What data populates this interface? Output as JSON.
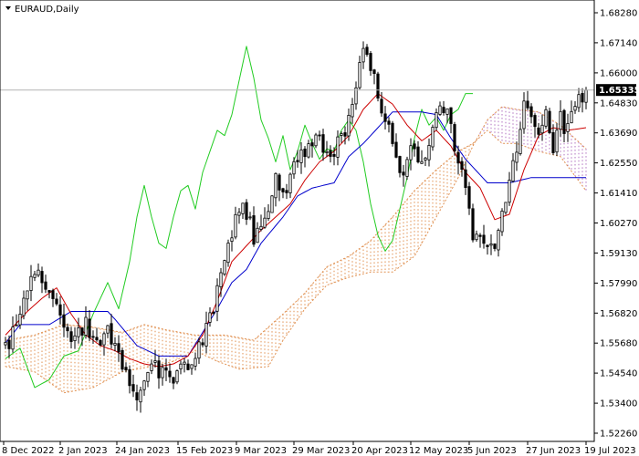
{
  "chart_data": {
    "type": "candlestick",
    "title": "EURAUD,Daily",
    "current_price": "1.65335",
    "y_ticks": [
      "1.68280",
      "1.67140",
      "1.66000",
      "1.64830",
      "1.63690",
      "1.62550",
      "1.61410",
      "1.60270",
      "1.59130",
      "1.57990",
      "1.56820",
      "1.55680",
      "1.54540",
      "1.53400",
      "1.52260"
    ],
    "ylim": [
      1.5226,
      1.6828
    ],
    "x_ticks": [
      {
        "label": "8 Dec 2022",
        "index": 0
      },
      {
        "label": "2 Jan 2023",
        "index": 17
      },
      {
        "label": "24 Jan 2023",
        "index": 33
      },
      {
        "label": "15 Feb 2023",
        "index": 49
      },
      {
        "label": "9 Mar 2023",
        "index": 65
      },
      {
        "label": "29 Mar 2023",
        "index": 79
      },
      {
        "label": "20 Apr 2023",
        "index": 95
      },
      {
        "label": "12 May 2023",
        "index": 111
      },
      {
        "label": "5 Jun 2023",
        "index": 127
      },
      {
        "label": "27 Jun 2023",
        "index": 143
      },
      {
        "label": "19 Jul 2023",
        "index": 159
      }
    ],
    "bar_count": 160,
    "price_path": [
      [
        0,
        1.556
      ],
      [
        3,
        1.562
      ],
      [
        6,
        1.579
      ],
      [
        9,
        1.583
      ],
      [
        12,
        1.576
      ],
      [
        16,
        1.564
      ],
      [
        19,
        1.558
      ],
      [
        22,
        1.565
      ],
      [
        25,
        1.556
      ],
      [
        28,
        1.562
      ],
      [
        31,
        1.55
      ],
      [
        34,
        1.54
      ],
      [
        36,
        1.532
      ],
      [
        38,
        1.54
      ],
      [
        41,
        1.548
      ],
      [
        44,
        1.546
      ],
      [
        47,
        1.544
      ],
      [
        50,
        1.549
      ],
      [
        53,
        1.556
      ],
      [
        56,
        1.566
      ],
      [
        59,
        1.582
      ],
      [
        62,
        1.6
      ],
      [
        65,
        1.61
      ],
      [
        68,
        1.598
      ],
      [
        71,
        1.605
      ],
      [
        74,
        1.618
      ],
      [
        77,
        1.615
      ],
      [
        80,
        1.626
      ],
      [
        83,
        1.632
      ],
      [
        86,
        1.635
      ],
      [
        89,
        1.628
      ],
      [
        92,
        1.635
      ],
      [
        95,
        1.648
      ],
      [
        97,
        1.662
      ],
      [
        99,
        1.67
      ],
      [
        101,
        1.656
      ],
      [
        103,
        1.648
      ],
      [
        105,
        1.64
      ],
      [
        107,
        1.628
      ],
      [
        109,
        1.623
      ],
      [
        111,
        1.63
      ],
      [
        113,
        1.626
      ],
      [
        116,
        1.63
      ],
      [
        118,
        1.642
      ],
      [
        120,
        1.647
      ],
      [
        122,
        1.64
      ],
      [
        124,
        1.625
      ],
      [
        126,
        1.615
      ],
      [
        128,
        1.6
      ],
      [
        130,
        1.596
      ],
      [
        132,
        1.592
      ],
      [
        134,
        1.595
      ],
      [
        136,
        1.606
      ],
      [
        138,
        1.621
      ],
      [
        140,
        1.633
      ],
      [
        142,
        1.647
      ],
      [
        144,
        1.64
      ],
      [
        146,
        1.636
      ],
      [
        148,
        1.644
      ],
      [
        150,
        1.63
      ],
      [
        152,
        1.642
      ],
      [
        154,
        1.637
      ],
      [
        156,
        1.648
      ],
      [
        159,
        1.6533
      ]
    ],
    "tenkan_path": [
      [
        0,
        1.56
      ],
      [
        6,
        1.569
      ],
      [
        10,
        1.574
      ],
      [
        14,
        1.578
      ],
      [
        18,
        1.568
      ],
      [
        22,
        1.56
      ],
      [
        26,
        1.556
      ],
      [
        30,
        1.554
      ],
      [
        34,
        1.551
      ],
      [
        38,
        1.549
      ],
      [
        42,
        1.548
      ],
      [
        46,
        1.549
      ],
      [
        50,
        1.552
      ],
      [
        54,
        1.56
      ],
      [
        58,
        1.573
      ],
      [
        62,
        1.588
      ],
      [
        66,
        1.594
      ],
      [
        70,
        1.6
      ],
      [
        74,
        1.605
      ],
      [
        78,
        1.61
      ],
      [
        82,
        1.619
      ],
      [
        86,
        1.626
      ],
      [
        90,
        1.63
      ],
      [
        94,
        1.636
      ],
      [
        98,
        1.646
      ],
      [
        102,
        1.652
      ],
      [
        106,
        1.648
      ],
      [
        110,
        1.64
      ],
      [
        114,
        1.634
      ],
      [
        118,
        1.638
      ],
      [
        122,
        1.632
      ],
      [
        126,
        1.622
      ],
      [
        130,
        1.616
      ],
      [
        134,
        1.604
      ],
      [
        138,
        1.606
      ],
      [
        142,
        1.623
      ],
      [
        146,
        1.636
      ],
      [
        150,
        1.639
      ],
      [
        154,
        1.638
      ],
      [
        159,
        1.639
      ]
    ],
    "kijun_path": [
      [
        0,
        1.557
      ],
      [
        4,
        1.564
      ],
      [
        12,
        1.564
      ],
      [
        18,
        1.569
      ],
      [
        28,
        1.569
      ],
      [
        30,
        1.566
      ],
      [
        36,
        1.556
      ],
      [
        42,
        1.552
      ],
      [
        50,
        1.552
      ],
      [
        54,
        1.561
      ],
      [
        58,
        1.57
      ],
      [
        62,
        1.58
      ],
      [
        66,
        1.585
      ],
      [
        70,
        1.595
      ],
      [
        76,
        1.605
      ],
      [
        80,
        1.613
      ],
      [
        84,
        1.616
      ],
      [
        90,
        1.618
      ],
      [
        94,
        1.628
      ],
      [
        98,
        1.633
      ],
      [
        106,
        1.645
      ],
      [
        114,
        1.645
      ],
      [
        118,
        1.644
      ],
      [
        122,
        1.635
      ],
      [
        126,
        1.627
      ],
      [
        132,
        1.618
      ],
      [
        138,
        1.618
      ],
      [
        144,
        1.62
      ],
      [
        159,
        1.62
      ]
    ],
    "chikou_path": [
      [
        0,
        1.551
      ],
      [
        4,
        1.555
      ],
      [
        8,
        1.54
      ],
      [
        12,
        1.543
      ],
      [
        16,
        1.552
      ],
      [
        20,
        1.554
      ],
      [
        24,
        1.568
      ],
      [
        28,
        1.58
      ],
      [
        31,
        1.57
      ],
      [
        34,
        1.588
      ],
      [
        36,
        1.605
      ],
      [
        38,
        1.617
      ],
      [
        40,
        1.605
      ],
      [
        42,
        1.595
      ],
      [
        44,
        1.593
      ],
      [
        46,
        1.605
      ],
      [
        48,
        1.615
      ],
      [
        50,
        1.617
      ],
      [
        52,
        1.608
      ],
      [
        54,
        1.622
      ],
      [
        56,
        1.63
      ],
      [
        58,
        1.638
      ],
      [
        60,
        1.636
      ],
      [
        62,
        1.644
      ],
      [
        64,
        1.657
      ],
      [
        66,
        1.67
      ],
      [
        68,
        1.658
      ],
      [
        70,
        1.642
      ],
      [
        72,
        1.635
      ],
      [
        74,
        1.626
      ],
      [
        76,
        1.636
      ],
      [
        78,
        1.623
      ],
      [
        80,
        1.63
      ],
      [
        82,
        1.64
      ],
      [
        84,
        1.633
      ],
      [
        86,
        1.627
      ],
      [
        88,
        1.631
      ],
      [
        90,
        1.63
      ],
      [
        92,
        1.638
      ],
      [
        94,
        1.642
      ],
      [
        96,
        1.638
      ],
      [
        98,
        1.626
      ],
      [
        100,
        1.61
      ],
      [
        102,
        1.598
      ],
      [
        104,
        1.592
      ],
      [
        106,
        1.596
      ],
      [
        108,
        1.608
      ],
      [
        110,
        1.62
      ],
      [
        112,
        1.635
      ],
      [
        114,
        1.646
      ],
      [
        116,
        1.64
      ],
      [
        118,
        1.643
      ],
      [
        120,
        1.638
      ],
      [
        122,
        1.644
      ],
      [
        124,
        1.646
      ],
      [
        126,
        1.652
      ],
      [
        128,
        1.652
      ]
    ],
    "span_a_path": [
      [
        0,
        1.558
      ],
      [
        8,
        1.56
      ],
      [
        16,
        1.564
      ],
      [
        24,
        1.563
      ],
      [
        32,
        1.561
      ],
      [
        38,
        1.564
      ],
      [
        44,
        1.562
      ],
      [
        52,
        1.56
      ],
      [
        60,
        1.56
      ],
      [
        68,
        1.558
      ],
      [
        76,
        1.568
      ],
      [
        82,
        1.576
      ],
      [
        88,
        1.586
      ],
      [
        94,
        1.59
      ],
      [
        100,
        1.596
      ],
      [
        106,
        1.605
      ],
      [
        112,
        1.615
      ],
      [
        118,
        1.623
      ],
      [
        124,
        1.63
      ],
      [
        128,
        1.633
      ],
      [
        132,
        1.638
      ],
      [
        136,
        1.633
      ],
      [
        140,
        1.633
      ],
      [
        146,
        1.63
      ],
      [
        152,
        1.628
      ],
      [
        159,
        1.615
      ]
    ],
    "span_b_path": [
      [
        0,
        1.548
      ],
      [
        8,
        1.546
      ],
      [
        16,
        1.538
      ],
      [
        24,
        1.54
      ],
      [
        32,
        1.546
      ],
      [
        40,
        1.548
      ],
      [
        46,
        1.55
      ],
      [
        52,
        1.554
      ],
      [
        58,
        1.55
      ],
      [
        64,
        1.547
      ],
      [
        72,
        1.548
      ],
      [
        76,
        1.558
      ],
      [
        82,
        1.57
      ],
      [
        88,
        1.579
      ],
      [
        94,
        1.582
      ],
      [
        100,
        1.584
      ],
      [
        106,
        1.584
      ],
      [
        112,
        1.59
      ],
      [
        118,
        1.605
      ],
      [
        124,
        1.62
      ],
      [
        128,
        1.632
      ],
      [
        132,
        1.642
      ],
      [
        136,
        1.647
      ],
      [
        140,
        1.646
      ],
      [
        146,
        1.645
      ],
      [
        152,
        1.64
      ],
      [
        159,
        1.631
      ]
    ],
    "colors": {
      "bull_candle": "#ffffff",
      "bear_candle": "#000000",
      "tenkan": "#cc0000",
      "kijun": "#0000cc",
      "chikou": "#22cc22",
      "cloud_up": "#e09050",
      "cloud_down": "#b070c0",
      "price_line": "#b4b4b4",
      "price_box": "#000000"
    }
  }
}
